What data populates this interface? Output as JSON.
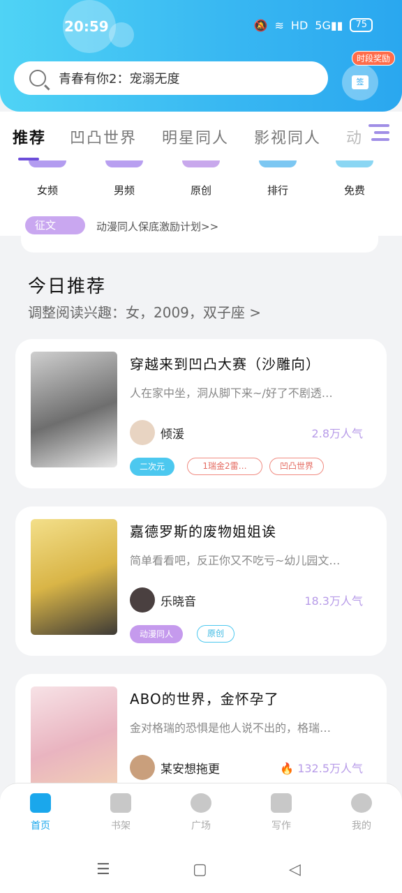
{
  "status": {
    "time": "20:59",
    "battery": "75",
    "hd": "HD",
    "net": "5G"
  },
  "search": {
    "text": "青春有你2：宠溺无度"
  },
  "gift_badge": "时段奖励",
  "gift_label": "签",
  "tabs": [
    "推荐",
    "凹凸世界",
    "明星同人",
    "影视同人",
    "动"
  ],
  "categories": [
    {
      "label": "女频",
      "color": "#b39cf0"
    },
    {
      "label": "男频",
      "color": "#b89ff0"
    },
    {
      "label": "原创",
      "color": "#c8a8ec"
    },
    {
      "label": "排行",
      "color": "#7cc7f2"
    },
    {
      "label": "免费",
      "color": "#8ad6f3"
    }
  ],
  "notice": {
    "tag": "征文",
    "text": "动漫同人保底激励计划>>"
  },
  "section": {
    "title": "今日推荐",
    "subtitle": "调整阅读兴趣：女，2009，双子座 >"
  },
  "books": [
    {
      "title": "穿越来到凹凸大赛（沙雕向）",
      "desc": "人在家中坐，洞从脚下来~/好了不剧透…",
      "author": "倾湲",
      "popularity": "2.8万人气",
      "tags": [
        "二次元",
        "1瑞金2雷…",
        "凹凸世界"
      ]
    },
    {
      "title": "嘉德罗斯的废物姐姐诶",
      "desc": "简单看看吧，反正你又不吃亏~幼儿园文…",
      "author": "乐晓音",
      "popularity": "18.3万人气",
      "tags": [
        "动漫同人",
        "原创"
      ]
    },
    {
      "title": "ABO的世界，金怀孕了",
      "desc": "金对格瑞的恐惧是他人说不出的，格瑞…",
      "author": "某安想拖更",
      "popularity": "132.5万人气",
      "tags": []
    }
  ],
  "nav": [
    "首页",
    "书架",
    "广场",
    "写作",
    "我的"
  ],
  "sys": {
    "menu": "☰",
    "home": "▢",
    "back": "◁"
  }
}
